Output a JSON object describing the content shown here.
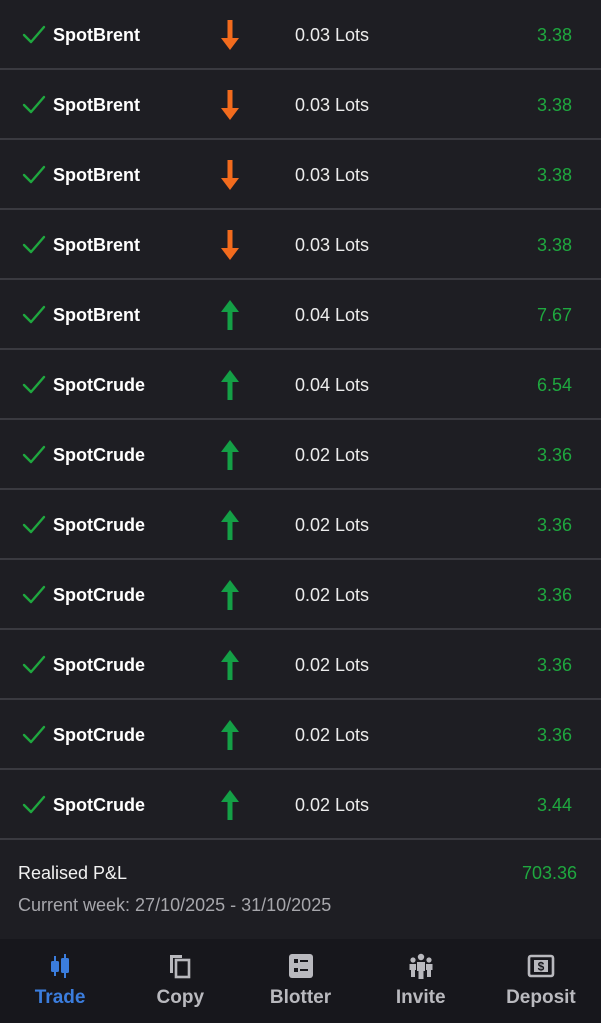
{
  "trades": [
    {
      "symbol": "SpotBrent",
      "direction": "down",
      "volume": "0.03 Lots",
      "profit": "3.38"
    },
    {
      "symbol": "SpotBrent",
      "direction": "down",
      "volume": "0.03 Lots",
      "profit": "3.38"
    },
    {
      "symbol": "SpotBrent",
      "direction": "down",
      "volume": "0.03 Lots",
      "profit": "3.38"
    },
    {
      "symbol": "SpotBrent",
      "direction": "down",
      "volume": "0.03 Lots",
      "profit": "3.38"
    },
    {
      "symbol": "SpotBrent",
      "direction": "up",
      "volume": "0.04 Lots",
      "profit": "7.67"
    },
    {
      "symbol": "SpotCrude",
      "direction": "up",
      "volume": "0.04 Lots",
      "profit": "6.54"
    },
    {
      "symbol": "SpotCrude",
      "direction": "up",
      "volume": "0.02 Lots",
      "profit": "3.36"
    },
    {
      "symbol": "SpotCrude",
      "direction": "up",
      "volume": "0.02 Lots",
      "profit": "3.36"
    },
    {
      "symbol": "SpotCrude",
      "direction": "up",
      "volume": "0.02 Lots",
      "profit": "3.36"
    },
    {
      "symbol": "SpotCrude",
      "direction": "up",
      "volume": "0.02 Lots",
      "profit": "3.36"
    },
    {
      "symbol": "SpotCrude",
      "direction": "up",
      "volume": "0.02 Lots",
      "profit": "3.36"
    },
    {
      "symbol": "SpotCrude",
      "direction": "up",
      "volume": "0.02 Lots",
      "profit": "3.44"
    }
  ],
  "summary": {
    "pnl_label": "Realised P&L",
    "pnl_value": "703.36",
    "week_range": "Current week: 27/10/2025 - 31/10/2025"
  },
  "nav": {
    "items": [
      {
        "key": "trade",
        "label": "Trade",
        "icon": "candlestick-icon",
        "active": true
      },
      {
        "key": "copy",
        "label": "Copy",
        "icon": "copy-icon",
        "active": false
      },
      {
        "key": "blotter",
        "label": "Blotter",
        "icon": "blotter-icon",
        "active": false
      },
      {
        "key": "invite",
        "label": "Invite",
        "icon": "people-icon",
        "active": false
      },
      {
        "key": "deposit",
        "label": "Deposit",
        "icon": "dollar-icon",
        "active": false
      }
    ]
  },
  "colors": {
    "background": "#1e1e23",
    "profit_green": "#1fa83f",
    "arrow_up": "#14a046",
    "arrow_down": "#f26b1d",
    "nav_active": "#3b7ddd",
    "nav_inactive": "#b9b9be"
  }
}
